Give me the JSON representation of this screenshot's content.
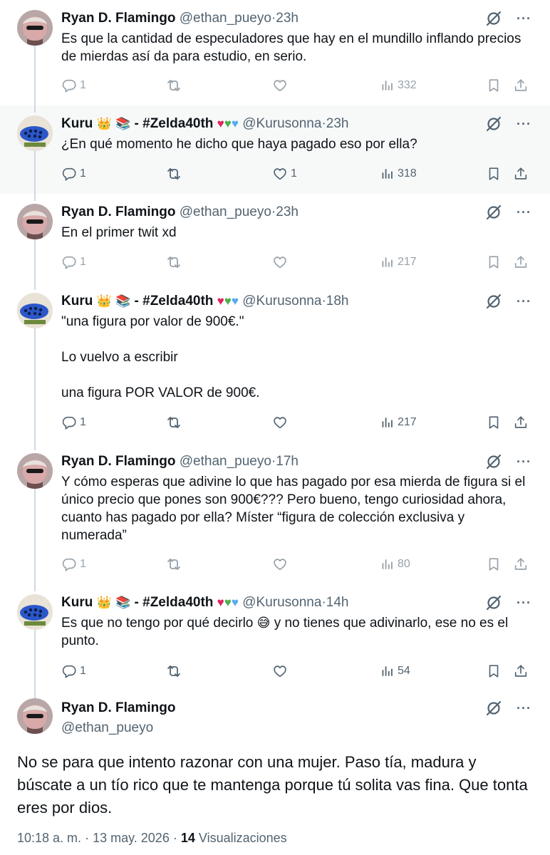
{
  "tweets": [
    {
      "name": "Ryan D. Flamingo",
      "handle": "@ethan_pueyo",
      "time": "23h",
      "text": [
        "Es que la cantidad de especuladores que hay en el mundillo inflando precios",
        "de mierdas así da para estudio, en serio."
      ],
      "replies": "1",
      "retweets": "",
      "likes": "",
      "views": "332"
    },
    {
      "name": "Kuru",
      "tag": "- #Zelda40th",
      "handle": "@Kurusonna",
      "time": "23h",
      "text": [
        "¿En qué momento he dicho que haya pagado eso por ella?"
      ],
      "replies": "1",
      "retweets": "",
      "likes": "1",
      "views": "318"
    },
    {
      "name": "Ryan D. Flamingo",
      "handle": "@ethan_pueyo",
      "time": "23h",
      "text": [
        "En el primer twit xd"
      ],
      "replies": "1",
      "retweets": "",
      "likes": "",
      "views": "217"
    },
    {
      "name": "Kuru",
      "tag": "- #Zelda40th",
      "handle": "@Kurusonna",
      "time": "18h",
      "text": [
        "\"una figura por valor de 900€.\"",
        "Lo vuelvo a escribir",
        "una figura POR VALOR de 900€."
      ],
      "replies": "1",
      "retweets": "",
      "likes": "",
      "views": "217"
    },
    {
      "name": "Ryan D. Flamingo",
      "handle": "@ethan_pueyo",
      "time": "17h",
      "text": [
        "Y cómo esperas que adivine lo que has pagado por esa mierda de figura si el",
        "único precio que pones son 900€??? Pero bueno, tengo curiosidad ahora,",
        "cuanto has pagado por ella? Míster “figura de colección exclusiva y",
        "numerada”"
      ],
      "replies": "1",
      "retweets": "",
      "likes": "",
      "views": "80"
    },
    {
      "name": "Kuru",
      "tag": "- #Zelda40th",
      "handle": "@Kurusonna",
      "time": "14h",
      "text_a": "Es que no tengo por qué decirlo",
      "text_b": "y no tienes que adivinarlo, ese no es el",
      "text_c": "punto.",
      "replies": "1",
      "retweets": "",
      "likes": "",
      "views": "54"
    }
  ],
  "main": {
    "name": "Ryan D. Flamingo",
    "handle": "@ethan_pueyo",
    "text": "No se para que intento razonar con una mujer. Paso tía, madura y búscate a un tío rico que te mantenga porque tú solita vas fina. Que tonta eres por dios.",
    "time": "10:18 a. m.",
    "date": "13 may. 2026",
    "views_count": "14",
    "views_label": "Visualizaciones"
  },
  "glyphs": {
    "dot": "·",
    "more": "···",
    "crown": "👑",
    "books": "📚",
    "heart_red": "♥",
    "heart_green": "♥",
    "heart_blue": "♥",
    "sweat_smile": "😅"
  },
  "colors": {
    "text": "#0f1419",
    "secondary": "#536471",
    "thread_line": "#cfd9de",
    "highlight_bg": "#f7f9f9"
  }
}
